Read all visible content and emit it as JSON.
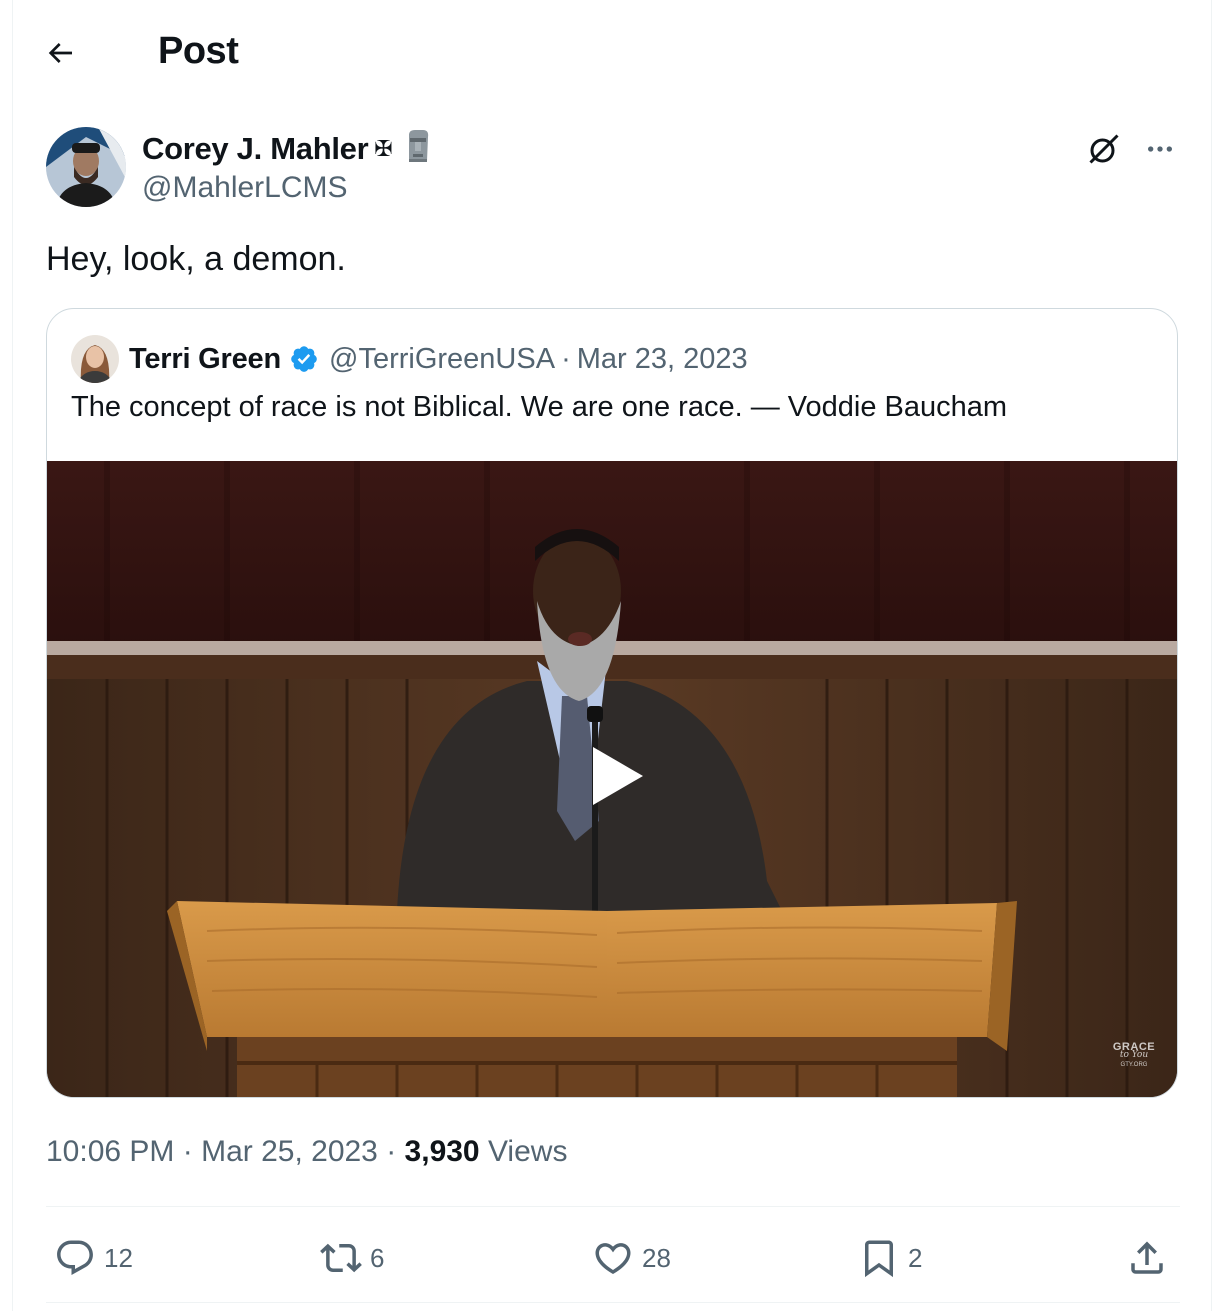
{
  "header": {
    "title": "Post"
  },
  "tweet": {
    "author_name": "Corey J. Mahler",
    "author_emoji": "✠",
    "author_handle": "@MahlerLCMS",
    "text": "Hey, look, a demon.",
    "time": "10:06 PM",
    "date": "Mar 25, 2023",
    "views_count": "3,930",
    "views_label": "Views"
  },
  "quote": {
    "author_name": "Terri Green",
    "author_handle": "@TerriGreenUSA",
    "separator": "·",
    "date": "Mar 23, 2023",
    "text": "The concept of race is not Biblical. We are one race. — Voddie Baucham",
    "watermark": {
      "top": "GRACE",
      "mid": "to You",
      "bottom": "GTY.ORG"
    }
  },
  "actions": {
    "replies": "12",
    "reposts": "6",
    "likes": "28",
    "bookmarks": "2"
  },
  "colors": {
    "text_primary": "#0f1419",
    "text_secondary": "#536471",
    "verified_blue": "#1d9bf0",
    "border": "#cfd9de"
  },
  "icons": [
    "back-arrow-icon",
    "moai-icon",
    "grok-icon",
    "more-icon",
    "verified-icon",
    "play-icon",
    "reply-icon",
    "repost-icon",
    "like-icon",
    "bookmark-icon",
    "share-icon"
  ]
}
